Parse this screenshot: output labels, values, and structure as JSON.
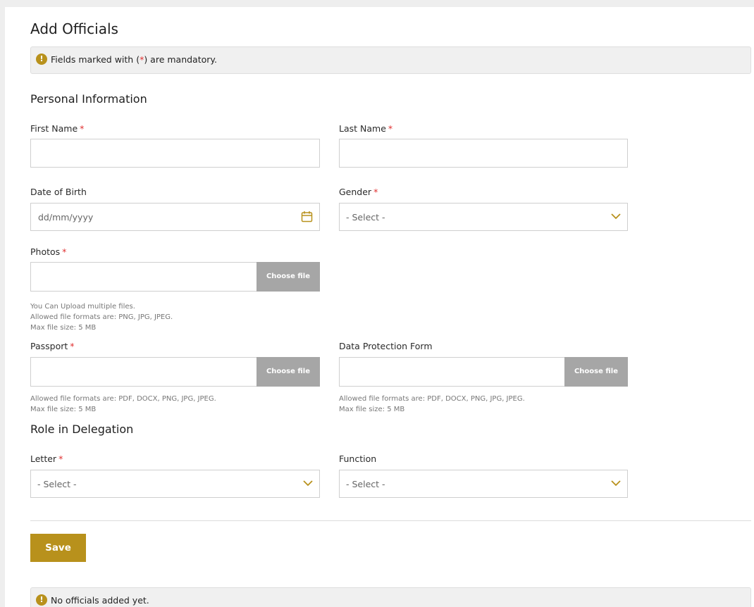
{
  "page": {
    "title": "Add Officials"
  },
  "mandatory_notice": {
    "icon": "exclamation-circle-icon",
    "prefix": "Fields marked with (",
    "star": "*",
    "suffix": ") are mandatory."
  },
  "sections": {
    "personal": "Personal Information",
    "role": "Role in Delegation"
  },
  "fields": {
    "first_name": {
      "label": "First Name",
      "required": "*",
      "value": ""
    },
    "last_name": {
      "label": "Last Name",
      "required": "*",
      "value": ""
    },
    "dob": {
      "label": "Date of Birth",
      "placeholder": "dd/mm/yyyy",
      "icon": "calendar-icon"
    },
    "gender": {
      "label": "Gender",
      "required": "*",
      "selected": "- Select -"
    },
    "photos": {
      "label": "Photos",
      "required": "*",
      "button": "Choose file",
      "help": [
        "You Can Upload multiple files.",
        "Allowed file formats are: PNG, JPG, JPEG.",
        "Max file size: 5 MB"
      ]
    },
    "passport": {
      "label": "Passport",
      "required": "*",
      "button": "Choose file",
      "help": [
        "Allowed file formats are: PDF, DOCX, PNG, JPG, JPEG.",
        "Max file size: 5 MB"
      ]
    },
    "data_protection": {
      "label": "Data Protection Form",
      "button": "Choose file",
      "help": [
        "Allowed file formats are: PDF, DOCX, PNG, JPG, JPEG.",
        "Max file size: 5 MB"
      ]
    },
    "letter": {
      "label": "Letter",
      "required": "*",
      "selected": "- Select -"
    },
    "function": {
      "label": "Function",
      "selected": "- Select -"
    }
  },
  "actions": {
    "save": "Save"
  },
  "empty_notice": {
    "icon": "exclamation-circle-icon",
    "text": "No officials added yet."
  },
  "colors": {
    "accent": "#b8911c",
    "required": "#e03030",
    "file_button": "#a6a6a6"
  }
}
